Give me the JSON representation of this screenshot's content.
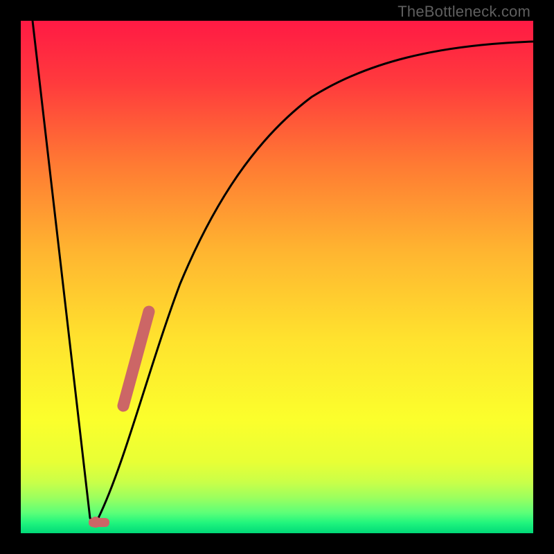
{
  "watermark": {
    "text": "TheBottleneck.com"
  },
  "colors": {
    "bg_black": "#000000",
    "grad_top": "#ff1a3f",
    "grad_mid1": "#ff6a2f",
    "grad_mid2": "#ffb92e",
    "grad_mid3": "#ffe62c",
    "grad_yellow": "#fbff2a",
    "grad_lime1": "#d8ff3a",
    "grad_lime2": "#a8ff55",
    "grad_green": "#34ff7a",
    "grad_green2": "#00e27a",
    "curve": "#000000",
    "marker": "#cc6666"
  },
  "chart_data": {
    "type": "line",
    "title": "",
    "xlabel": "",
    "ylabel": "",
    "xlim": [
      0,
      100
    ],
    "ylim": [
      0,
      100
    ],
    "series": [
      {
        "name": "bottleneck-curve",
        "x": [
          0,
          2,
          4,
          6,
          8,
          10,
          12,
          13,
          14,
          16,
          18,
          20,
          22,
          24,
          26,
          28,
          30,
          33,
          36,
          40,
          45,
          50,
          55,
          60,
          65,
          70,
          75,
          80,
          85,
          90,
          95,
          100
        ],
        "values": [
          100,
          86,
          71,
          57,
          43,
          29,
          14,
          3,
          0,
          8,
          18,
          27,
          35,
          42,
          49,
          55,
          60,
          66,
          71,
          76,
          81,
          84,
          86.5,
          88.5,
          90,
          91.2,
          92.2,
          93,
          93.6,
          94.1,
          94.5,
          94.8
        ]
      }
    ],
    "markers": [
      {
        "name": "optimal-point",
        "x": 13.5,
        "y": 0.5
      },
      {
        "name": "marker-segment-start",
        "x": 19,
        "y": 22
      },
      {
        "name": "marker-segment-end",
        "x": 24,
        "y": 42
      }
    ],
    "notes": "Values are read off the chart visually; y-axis interpreted as bottleneck percentage (0 at bottom green, 100 at top red). No numeric axis ticks are printed in the image."
  }
}
